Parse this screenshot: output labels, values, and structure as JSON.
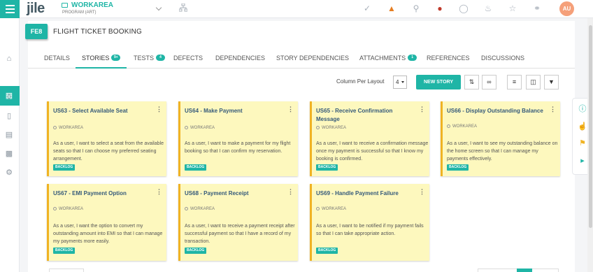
{
  "header": {
    "logo": "jile",
    "workspace_name": "WORKAREA",
    "workspace_sub": "PROGRAM (ART)",
    "avatar_initials": "AU"
  },
  "page": {
    "badge": "FE8",
    "title": "FLIGHT TICKET BOOKING"
  },
  "tabs": [
    {
      "label": "DETAILS"
    },
    {
      "label": "STORIES",
      "count": "9+"
    },
    {
      "label": "TESTS",
      "count": "4"
    },
    {
      "label": "DEFECTS"
    },
    {
      "label": "DEPENDENCIES"
    },
    {
      "label": "STORY DEPENDENCIES"
    },
    {
      "label": "ATTACHMENTS",
      "count": "1"
    },
    {
      "label": "REFERENCES"
    },
    {
      "label": "DISCUSSIONS"
    }
  ],
  "toolbar": {
    "layout_label": "Column Per Layout",
    "layout_value": "4",
    "new_story_label": "NEW STORY"
  },
  "cards": [
    {
      "title": "US63 - Select Available Seat",
      "workspace": "WORKAREA",
      "desc": "As a user, I want to select a seat from the available seats so that I can choose my preferred seating arrangement.",
      "status": "BACKLOG"
    },
    {
      "title": "US64 - Make Payment",
      "workspace": "WORKAREA",
      "desc": "As a user, I want to make a payment for my flight booking so that I can confirm my reservation.",
      "status": "BACKLOG"
    },
    {
      "title": "US65 - Receive Confirmation Message",
      "workspace": "WORKAREA",
      "desc": "As a user, I want to receive a confirmation message once my payment is successful so that I know my booking is confirmed.",
      "status": "BACKLOG"
    },
    {
      "title": "US66 - Display Outstanding Balance",
      "workspace": "WORKAREA",
      "desc": "As a user, I want to see my outstanding balance on the home screen so that I can manage my payments effectively.",
      "status": "BACKLOG"
    },
    {
      "title": "US67 - EMI Payment Option",
      "workspace": "WORKAREA",
      "desc": "As a user, I want the option to convert my outstanding amount into EMI so that I can manage my payments more easily.",
      "status": "BACKLOG"
    },
    {
      "title": "US68 - Payment Receipt",
      "workspace": "WORKAREA",
      "desc": "As a user, I want to receive a payment receipt after successful payment so that I have a record of my transaction.",
      "status": "BACKLOG"
    },
    {
      "title": "US69 - Handle Payment Failure",
      "workspace": "WORKAREA",
      "desc": "As a user, I want to be notified if my payment fails so that I can take appropriate action.",
      "status": "BACKLOG"
    }
  ]
}
